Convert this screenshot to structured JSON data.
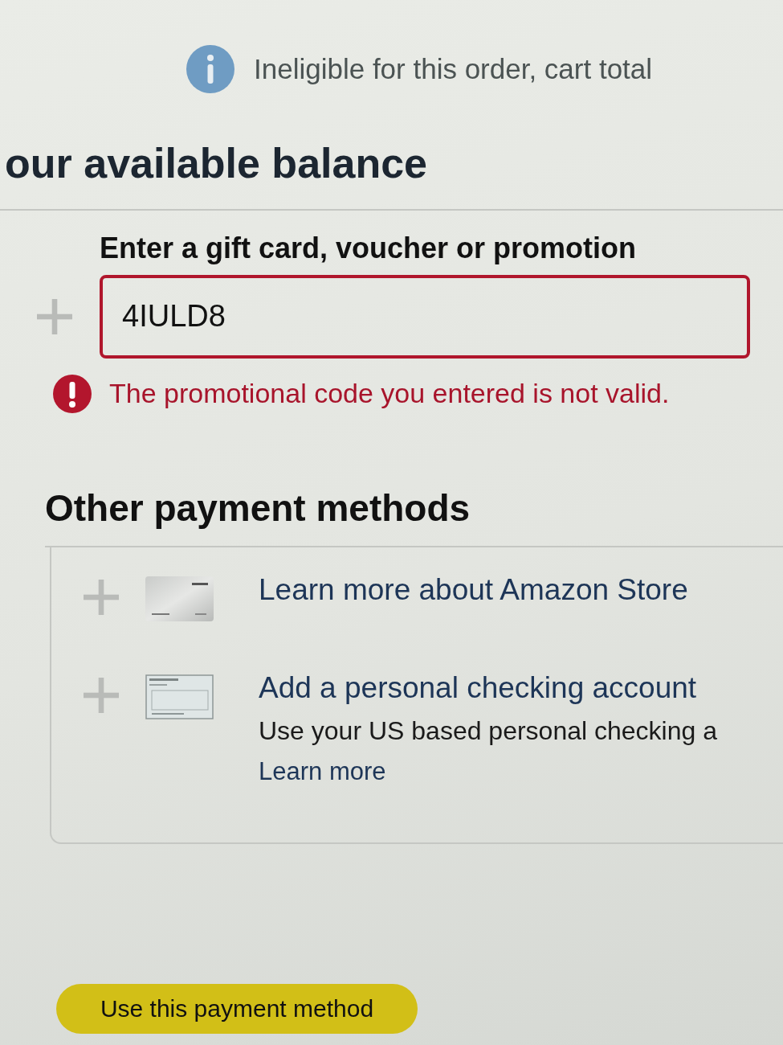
{
  "notice": {
    "text": "Ineligible for this order, cart total"
  },
  "balance": {
    "title": "our available balance",
    "field": {
      "label": "Enter a gift card, voucher or promotion",
      "value": "4IULD8",
      "invalid": true
    },
    "error": "The promotional code you entered is not valid."
  },
  "other_methods": {
    "title": "Other payment methods",
    "items": [
      {
        "kind": "store_card",
        "title": "Learn more about Amazon Store"
      },
      {
        "kind": "checking_account",
        "title": "Add a personal checking account",
        "description": "Use your US based personal checking a",
        "link": "Learn more"
      }
    ]
  },
  "primary_button": {
    "label": "Use this payment method"
  }
}
